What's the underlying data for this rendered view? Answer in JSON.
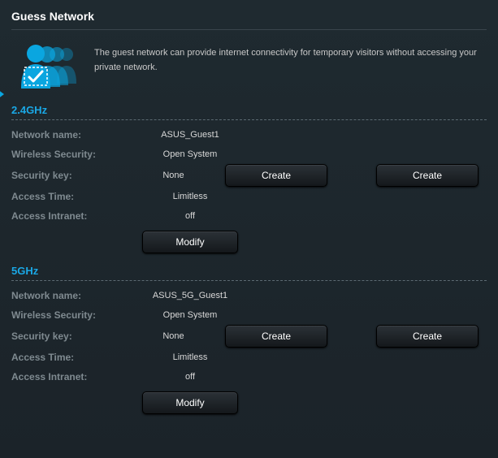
{
  "page": {
    "title": "Guess Network"
  },
  "intro": {
    "text": "The guest network can provide internet connectivity for temporary visitors without accessing your private network."
  },
  "labels": {
    "network_name": "Network name:",
    "wireless_security": "Wireless Security:",
    "security_key": "Security key:",
    "access_time": "Access Time:",
    "access_intranet": "Access Intranet:"
  },
  "buttons": {
    "create": "Create",
    "modify": "Modify"
  },
  "bands": {
    "g24": {
      "title": "2.4GHz",
      "network_name": "ASUS_Guest1",
      "wireless_security": "Open System",
      "security_key": "None",
      "access_time": "Limitless",
      "access_intranet": "off"
    },
    "g5": {
      "title": "5GHz",
      "network_name": "ASUS_5G_Guest1",
      "wireless_security": "Open System",
      "security_key": "None",
      "access_time": "Limitless",
      "access_intranet": "off"
    }
  }
}
